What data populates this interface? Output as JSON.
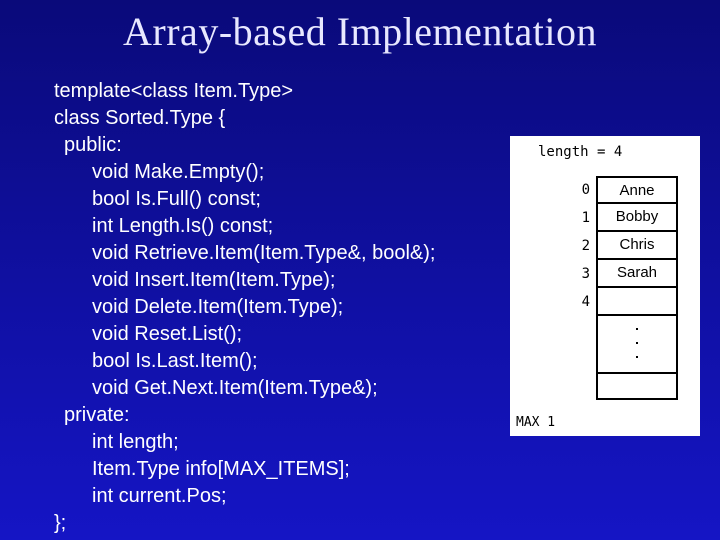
{
  "title": "Array-based Implementation",
  "code": {
    "lines": [
      {
        "cls": "",
        "t": "template<class Item.Type>"
      },
      {
        "cls": "",
        "t": "class Sorted.Type {"
      },
      {
        "cls": "ind1",
        "t": "public:"
      },
      {
        "cls": "ind2",
        "t": "void Make.Empty();"
      },
      {
        "cls": "ind2",
        "t": "bool Is.Full() const;"
      },
      {
        "cls": "ind2",
        "t": "int Length.Is() const;"
      },
      {
        "cls": "ind2",
        "t": "void Retrieve.Item(Item.Type&, bool&);"
      },
      {
        "cls": "ind2",
        "t": "void Insert.Item(Item.Type);"
      },
      {
        "cls": "ind2",
        "t": "void Delete.Item(Item.Type);"
      },
      {
        "cls": "ind2",
        "t": "void Reset.List();"
      },
      {
        "cls": "ind2",
        "t": "bool Is.Last.Item();"
      },
      {
        "cls": "ind2",
        "t": "void Get.Next.Item(Item.Type&);"
      },
      {
        "cls": "ind1",
        "t": "private:"
      },
      {
        "cls": "ind2",
        "t": "int length;"
      },
      {
        "cls": "ind2",
        "t": "Item.Type info[MAX_ITEMS];"
      },
      {
        "cls": "ind2",
        "t": "int current.Pos;"
      },
      {
        "cls": "",
        "t": "};"
      }
    ]
  },
  "diagram": {
    "length_label": "length = 4",
    "rows": [
      {
        "idx": "0",
        "val": "Anne"
      },
      {
        "idx": "1",
        "val": "Bobby"
      },
      {
        "idx": "2",
        "val": "Chris"
      },
      {
        "idx": "3",
        "val": "Sarah"
      },
      {
        "idx": "4",
        "val": ""
      }
    ],
    "max_label": "MAX 1",
    "last_val": ""
  }
}
